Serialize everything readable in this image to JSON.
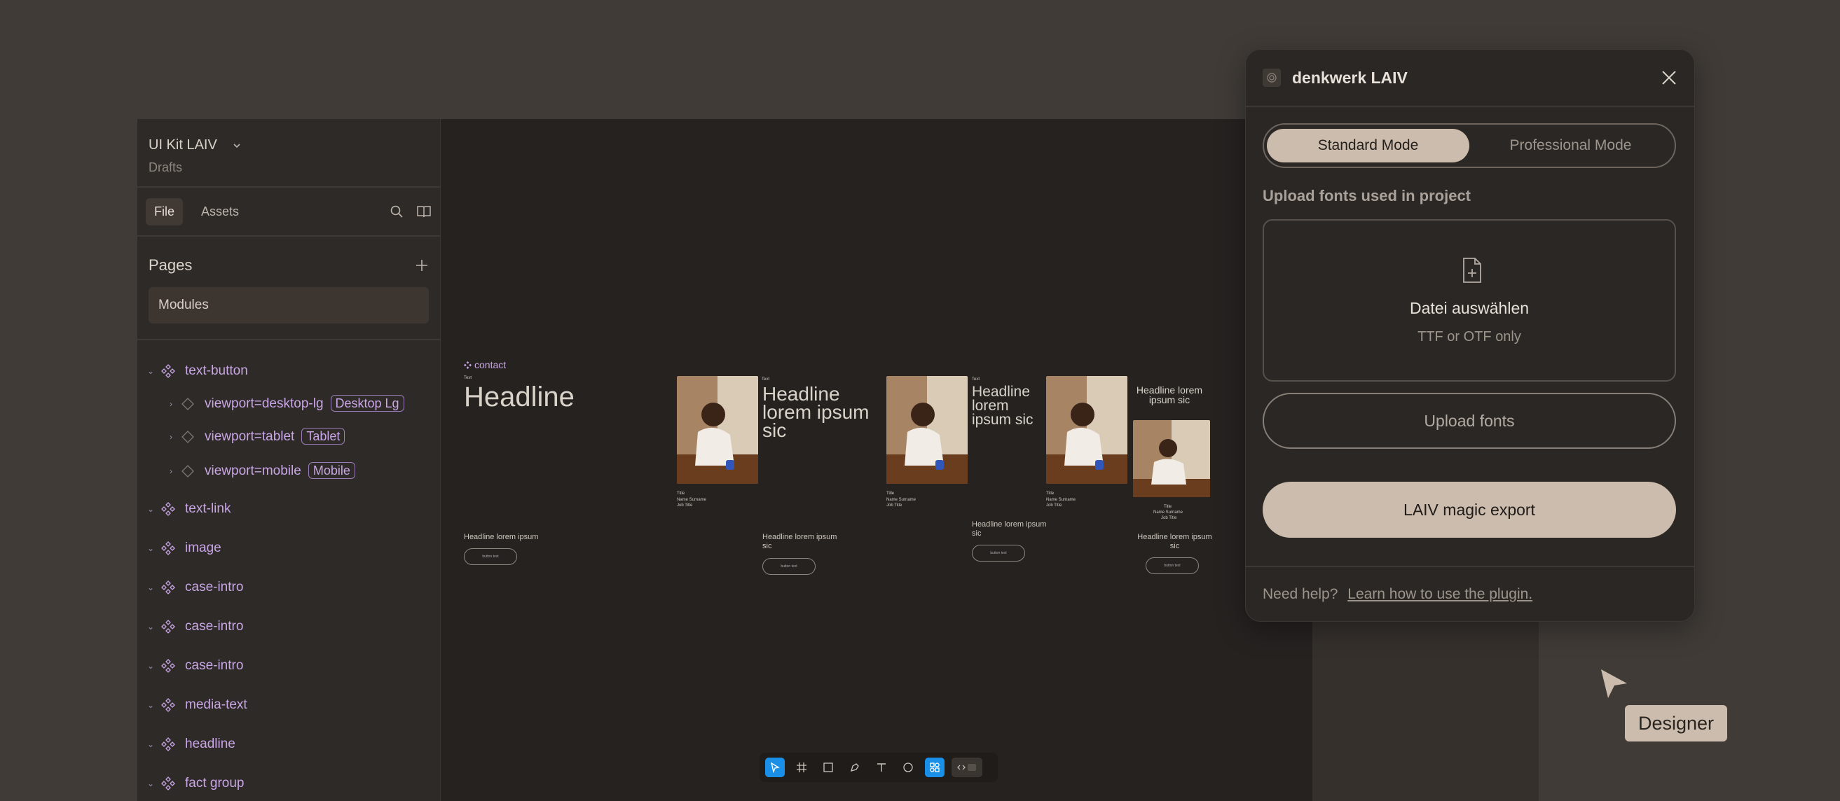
{
  "sidebar": {
    "project_name": "UI Kit LAIV",
    "project_sub": "Drafts",
    "tabs": {
      "file": "File",
      "assets": "Assets"
    },
    "pages_title": "Pages",
    "pages": [
      "Modules"
    ],
    "layers": [
      {
        "label": "text-button",
        "level": 0
      },
      {
        "label": "viewport=desktop-lg",
        "badge": "Desktop Lg",
        "level": 1
      },
      {
        "label": "viewport=tablet",
        "badge": "Tablet",
        "level": 1
      },
      {
        "label": "viewport=mobile",
        "badge": "Mobile",
        "level": 1
      },
      {
        "label": "text-link",
        "level": 0
      },
      {
        "label": "image",
        "level": 0
      },
      {
        "label": "case-intro",
        "level": 0
      },
      {
        "label": "case-intro",
        "level": 0
      },
      {
        "label": "case-intro",
        "level": 0
      },
      {
        "label": "media-text",
        "level": 0
      },
      {
        "label": "headline",
        "level": 0
      },
      {
        "label": "fact group",
        "level": 0
      }
    ]
  },
  "canvas": {
    "component_label": "contact",
    "frame1": {
      "headline": "Headline",
      "body": "Headline lorem ipsum"
    },
    "frame2": {
      "headline": "Headline lorem ipsum sic",
      "name": "Name Surname",
      "body": "Headline lorem ipsum sic"
    },
    "frame3": {
      "headline": "Headline lorem ipsum sic",
      "name": "Name Surname",
      "body": "Headline lorem ipsum sic"
    },
    "frame4": {
      "headline": "Headline lorem ipsum sic",
      "name": "Name Surname",
      "body": "Headline lorem ipsum sic"
    }
  },
  "plugin": {
    "title": "denkwerk LAIV",
    "modes": [
      "Standard Mode",
      "Professional Mode"
    ],
    "active_mode": "Standard Mode",
    "upload_label": "Upload fonts used in project",
    "dropzone_title": "Datei auswählen",
    "dropzone_sub": "TTF or OTF only",
    "upload_button": "Upload fonts",
    "export_button": "LAIV magic export",
    "help_text": "Need help?",
    "help_link": "Learn how to use the plugin."
  },
  "cursor_label": "Designer",
  "colors": {
    "accent": "#cbbcad",
    "layer": "#c9a6e6",
    "selected_tool": "#1a8fe8"
  }
}
